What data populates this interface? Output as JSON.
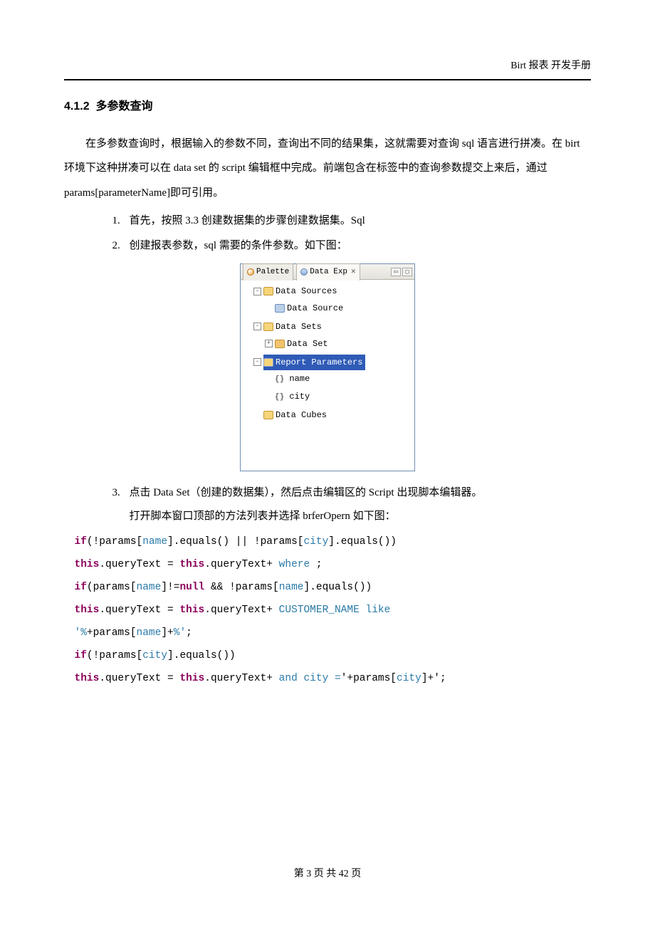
{
  "header": {
    "title": "Birt 报表 开发手册"
  },
  "section": {
    "number": "4.1.2",
    "title": "多参数查询"
  },
  "paragraph": "在多参数查询时，根据输入的参数不同，查询出不同的结果集，这就需要对查询 sql 语言进行拼凑。在 birt 环境下这种拼凑可以在 data set 的 script 编辑框中完成。前端包含在标签中的查询参数提交上来后，通过 params[parameterName]即可引用。",
  "list": [
    {
      "num": "1.",
      "text": "首先，按照 3.3 创建数据集的步骤创建数据集。Sql"
    },
    {
      "num": "2.",
      "text": "创建报表参数，sql 需要的条件参数。如下图："
    },
    {
      "num": "3.",
      "text": "点击 Data Set（创建的数据集），然后点击编辑区的 Script 出现脚本编辑器。",
      "sub": "打开脚本窗口顶部的方法列表并选择 brferOpern 如下图："
    }
  ],
  "panel": {
    "tabs": {
      "palette": "Palette",
      "dataexp": "Data Exp"
    },
    "tree": {
      "dataSources": "Data Sources",
      "dataSource": "Data Source",
      "dataSets": "Data Sets",
      "dataSet": "Data Set",
      "reportParameters": "Report Parameters",
      "p1": "name",
      "p2": "city",
      "dataCubes": "Data Cubes"
    }
  },
  "code": {
    "l1a": "if",
    "l1b": "(!params[",
    "l1c": "name",
    "l1d": "].equals() || !params[",
    "l1e": "city",
    "l1f": "].equals())",
    "l2a": "this",
    "l2b": ".queryText = ",
    "l2c": "this",
    "l2d": ".queryText+",
    "l2e": " where ",
    "l2f": ";",
    "l3a": "if",
    "l3b": "(params[",
    "l3c": "name",
    "l3d": "]!=",
    "l3e": "null",
    "l3f": " && !params[",
    "l3g": "name",
    "l3h": "].equals())",
    "l4a": "this",
    "l4b": ".queryText = ",
    "l4c": "this",
    "l4d": ".queryText+ ",
    "l4e": " CUSTOMER_NAME like",
    "l5a": "'%",
    "l5b": "+params[",
    "l5c": "name",
    "l5d": "]+",
    "l5e": "%'",
    "l5f": ";",
    "l6a": "if",
    "l6b": "(!params[",
    "l6c": "city",
    "l6d": "].equals())",
    "l7a": "this",
    "l7b": ".queryText = ",
    "l7c": "this",
    "l7d": ".queryText+",
    "l7e": " and city =",
    "l7f": "'+params[",
    "l7g": "city",
    "l7h": "]+'",
    "l7i": ";"
  },
  "footer": {
    "text": "第 3 页 共 42 页"
  }
}
